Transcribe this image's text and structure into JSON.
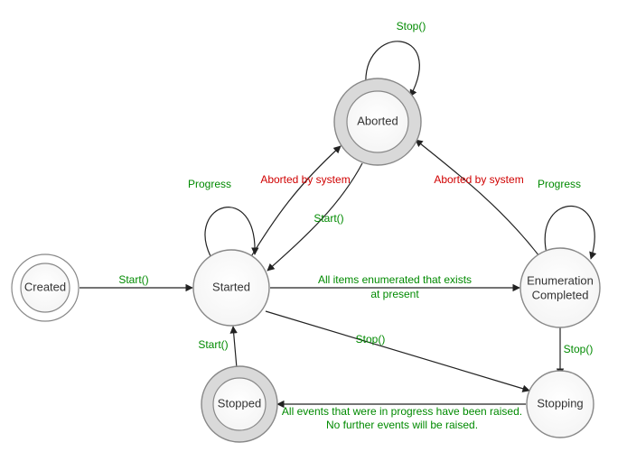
{
  "chart_data": {
    "type": "state_diagram",
    "title": "",
    "states": {
      "created": {
        "label": "Created",
        "initial": true,
        "final": false
      },
      "started": {
        "label": "Started",
        "initial": false,
        "final": false
      },
      "aborted": {
        "label": "Aborted",
        "initial": false,
        "final": true
      },
      "enum": {
        "label": "Enumeration Completed",
        "initial": false,
        "final": false
      },
      "stopping": {
        "label": "Stopping",
        "initial": false,
        "final": false
      },
      "stopped": {
        "label": "Stopped",
        "initial": false,
        "final": true
      }
    },
    "transitions": [
      {
        "from": "created",
        "to": "started",
        "label": "Start()",
        "kind": "call"
      },
      {
        "from": "started",
        "to": "started",
        "label": "Progress",
        "kind": "event"
      },
      {
        "from": "started",
        "to": "aborted",
        "label": "Aborted by system",
        "kind": "system"
      },
      {
        "from": "aborted",
        "to": "started",
        "label": "Start()",
        "kind": "call"
      },
      {
        "from": "aborted",
        "to": "aborted",
        "label": "Stop()",
        "kind": "call"
      },
      {
        "from": "started",
        "to": "enum",
        "label": "All items enumerated that exists at present",
        "kind": "event"
      },
      {
        "from": "enum",
        "to": "enum",
        "label": "Progress",
        "kind": "event"
      },
      {
        "from": "enum",
        "to": "aborted",
        "label": "Aborted by system",
        "kind": "system"
      },
      {
        "from": "started",
        "to": "stopping",
        "label": "Stop()",
        "kind": "call"
      },
      {
        "from": "enum",
        "to": "stopping",
        "label": "Stop()",
        "kind": "call"
      },
      {
        "from": "stopping",
        "to": "stopped",
        "label": "All events that were in progress have been raised. No further events will be raised.",
        "kind": "event"
      },
      {
        "from": "stopped",
        "to": "started",
        "label": "Start()",
        "kind": "call"
      }
    ]
  },
  "nodes": {
    "created": {
      "label": "Created"
    },
    "started": {
      "label": "Started"
    },
    "aborted": {
      "label": "Aborted"
    },
    "enum": {
      "label1": "Enumeration",
      "label2": "Completed"
    },
    "stopping": {
      "label": "Stopping"
    },
    "stopped": {
      "label": "Stopped"
    }
  },
  "labels": {
    "start": "Start()",
    "stop": "Stop()",
    "progress": "Progress",
    "aborted_by_system": "Aborted by system",
    "all_items_1": "All items enumerated that exists",
    "all_items_2": "at present",
    "all_events_1": "All events that were in progress have been raised.",
    "all_events_2": "No further events will be raised."
  }
}
